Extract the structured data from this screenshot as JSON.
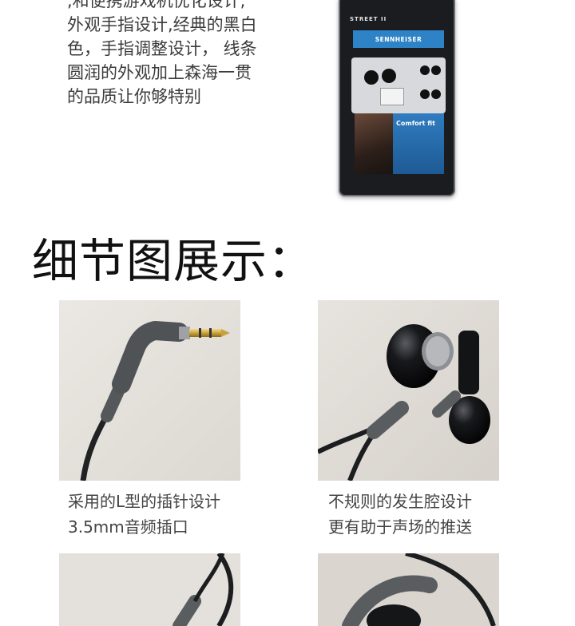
{
  "intro": {
    "lines": [
      ",和便携游戏机优化设计,",
      "外观手指设计,经典的黑白",
      "色，手指调整设计， 线条",
      "圆润的外观加上森海一贯",
      "的品质让你够特别"
    ]
  },
  "package": {
    "series_label": "STREET II",
    "brand": "SENNHEISER",
    "tagline": "Comfort fit"
  },
  "section": {
    "heading": "细节图展示："
  },
  "details": [
    {
      "caption_lines": [
        "采用的L型的插针设计",
        "3.5mm音频插口"
      ]
    },
    {
      "caption_lines": [
        "不规则的发生腔设计",
        "更有助于声场的推送"
      ]
    }
  ],
  "colors": {
    "brand_blue": "#2e83c6",
    "cable_gray": "#55585a",
    "earbud_black": "#0e0e10",
    "photo_bg": "#e6e2dd"
  }
}
